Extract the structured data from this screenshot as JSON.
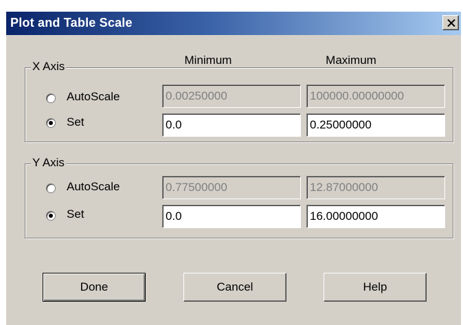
{
  "window": {
    "title": "Plot and Table Scale",
    "close_glyph": "✕"
  },
  "columns": {
    "minimum": "Minimum",
    "maximum": "Maximum"
  },
  "x_axis": {
    "label": "X Axis",
    "autoscale_label": "AutoScale",
    "set_label": "Set",
    "selected": "set",
    "autoscale_min": "0.00250000",
    "autoscale_max": "100000.00000000",
    "set_min": "0.0",
    "set_max": "0.25000000"
  },
  "y_axis": {
    "label": "Y Axis",
    "autoscale_label": "AutoScale",
    "set_label": "Set",
    "selected": "set",
    "autoscale_min": "0.77500000",
    "autoscale_max": "12.87000000",
    "set_min": "0.0",
    "set_max": "16.00000000"
  },
  "buttons": {
    "done": "Done",
    "cancel": "Cancel",
    "help": "Help"
  },
  "colors": {
    "dialog_bg": "#d4d0c8",
    "title_start": "#0a246a",
    "title_end": "#a6caf0"
  }
}
